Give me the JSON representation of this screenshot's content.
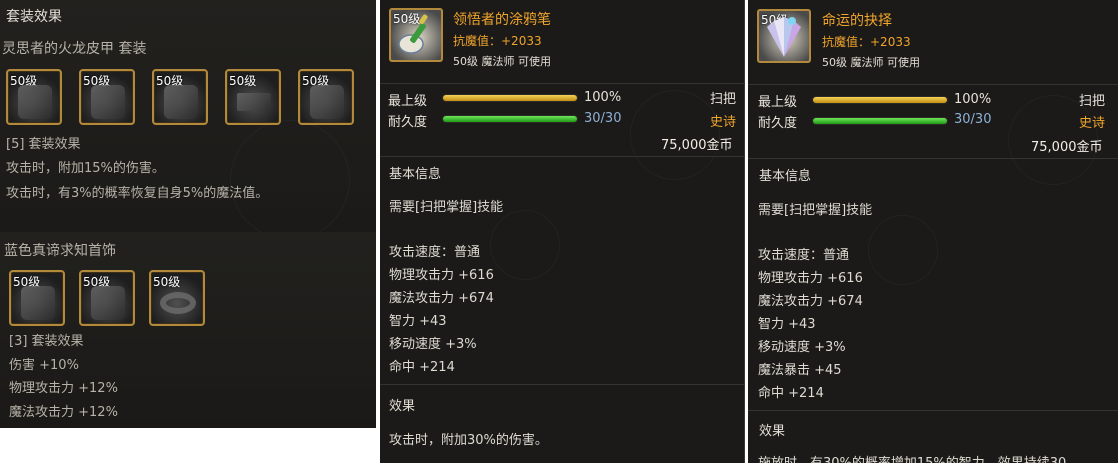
{
  "set_panel_1": {
    "title": "套装效果",
    "set_name": "灵思者的火龙皮甲  套装",
    "slots": [
      "50级",
      "50级",
      "50级",
      "50级",
      "50级"
    ],
    "effect_header": "[5] 套装效果",
    "effects": [
      "攻击时，附加15%的伤害。",
      "攻击时，有3%的概率恢复自身5%的魔法值。"
    ]
  },
  "set_panel_2": {
    "set_name": "蓝色真谛求知首饰",
    "slots": [
      "50级",
      "50级",
      "50级"
    ],
    "effect_header": "[3] 套装效果",
    "effects": [
      "伤害 +10%",
      "物理攻击力 +12%",
      "魔法攻击力 +12%"
    ]
  },
  "item_1": {
    "level_badge": "50级",
    "icon": "brush-icon",
    "name": "领悟者的涂鸦笔",
    "resist": "抗魔值：+2033",
    "usable": "50级 魔法师 可使用",
    "grade_label": "最上级",
    "grade_value": "100%",
    "grade_fill": 1.0,
    "type": "扫把",
    "durability_label": "耐久度",
    "durability_value": "30/30",
    "durability_fill": 1.0,
    "rarity": "史诗",
    "price": "75,000金币",
    "basic_header": "基本信息",
    "requirement": "需要[扫把掌握]技能",
    "stats": [
      "攻击速度：普通",
      "物理攻击力 +616",
      "魔法攻击力 +674",
      "智力 +43",
      "移动速度 +3%",
      "命中 +214"
    ],
    "effect_header": "效果",
    "effect": "攻击时，附加30%的伤害。"
  },
  "item_2": {
    "level_badge": "50级",
    "icon": "fan-icon",
    "name": "命运的抉择",
    "resist": "抗魔值：+2033",
    "usable": "50级 魔法师 可使用",
    "grade_label": "最上级",
    "grade_value": "100%",
    "grade_fill": 1.0,
    "type": "扫把",
    "durability_label": "耐久度",
    "durability_value": "30/30",
    "durability_fill": 1.0,
    "rarity": "史诗",
    "price": "75,000金币",
    "basic_header": "基本信息",
    "requirement": "需要[扫把掌握]技能",
    "stats": [
      "攻击速度：普通",
      "物理攻击力 +616",
      "魔法攻击力 +674",
      "智力 +43",
      "移动速度 +3%",
      "魔法暴击 +45",
      "命中 +214"
    ],
    "effect_header": "效果",
    "effect": "施放时，有30%的概率增加15%的智力，效果持续30"
  },
  "colors": {
    "accent_gold": "#f0a52c",
    "grade_bar": "#e0b321",
    "durability_bar": "#3fbf2a",
    "frame": "#b38a3c"
  }
}
